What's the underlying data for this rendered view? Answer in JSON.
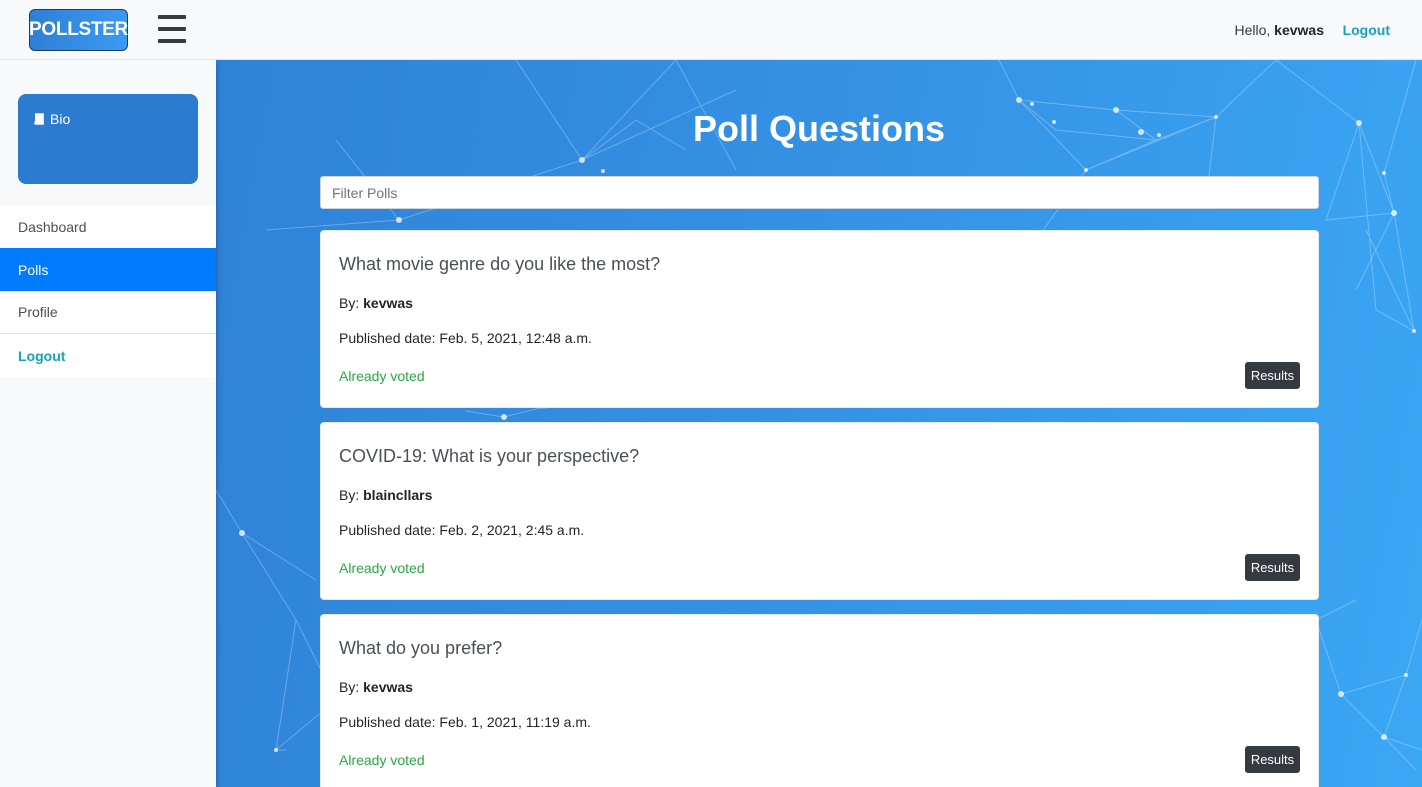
{
  "header": {
    "brand": "POLLSTER",
    "greeting_prefix": "Hello,",
    "username": "kevwas",
    "logout_label": "Logout"
  },
  "sidebar": {
    "bio_label": "Bio",
    "items": [
      {
        "label": "Dashboard",
        "active": false
      },
      {
        "label": "Polls",
        "active": true
      },
      {
        "label": "Profile",
        "active": false
      },
      {
        "label": "Logout",
        "active": false
      }
    ]
  },
  "main": {
    "title": "Poll Questions",
    "filter_placeholder": "Filter Polls",
    "polls": [
      {
        "question": "What movie genre do you like the most?",
        "by_label": "By:",
        "author": "kevwas",
        "published": "Published date: Feb. 5, 2021, 12:48 a.m.",
        "status": "Already voted",
        "button": "Results"
      },
      {
        "question": "COVID-19: What is your perspective?",
        "by_label": "By:",
        "author": "blaincllars",
        "published": "Published date: Feb. 2, 2021, 2:45 a.m.",
        "status": "Already voted",
        "button": "Results"
      },
      {
        "question": "What do you prefer?",
        "by_label": "By:",
        "author": "kevwas",
        "published": "Published date: Feb. 1, 2021, 11:19 a.m.",
        "status": "Already voted",
        "button": "Results"
      }
    ]
  },
  "colors": {
    "accent": "#007bff",
    "teal_link": "#17a2b8",
    "voted_green": "#28a745",
    "bio_card": "#2c7bd0",
    "button_dark": "#343a40"
  },
  "icons": {
    "bio": "book-icon",
    "menu": "hamburger-icon"
  }
}
